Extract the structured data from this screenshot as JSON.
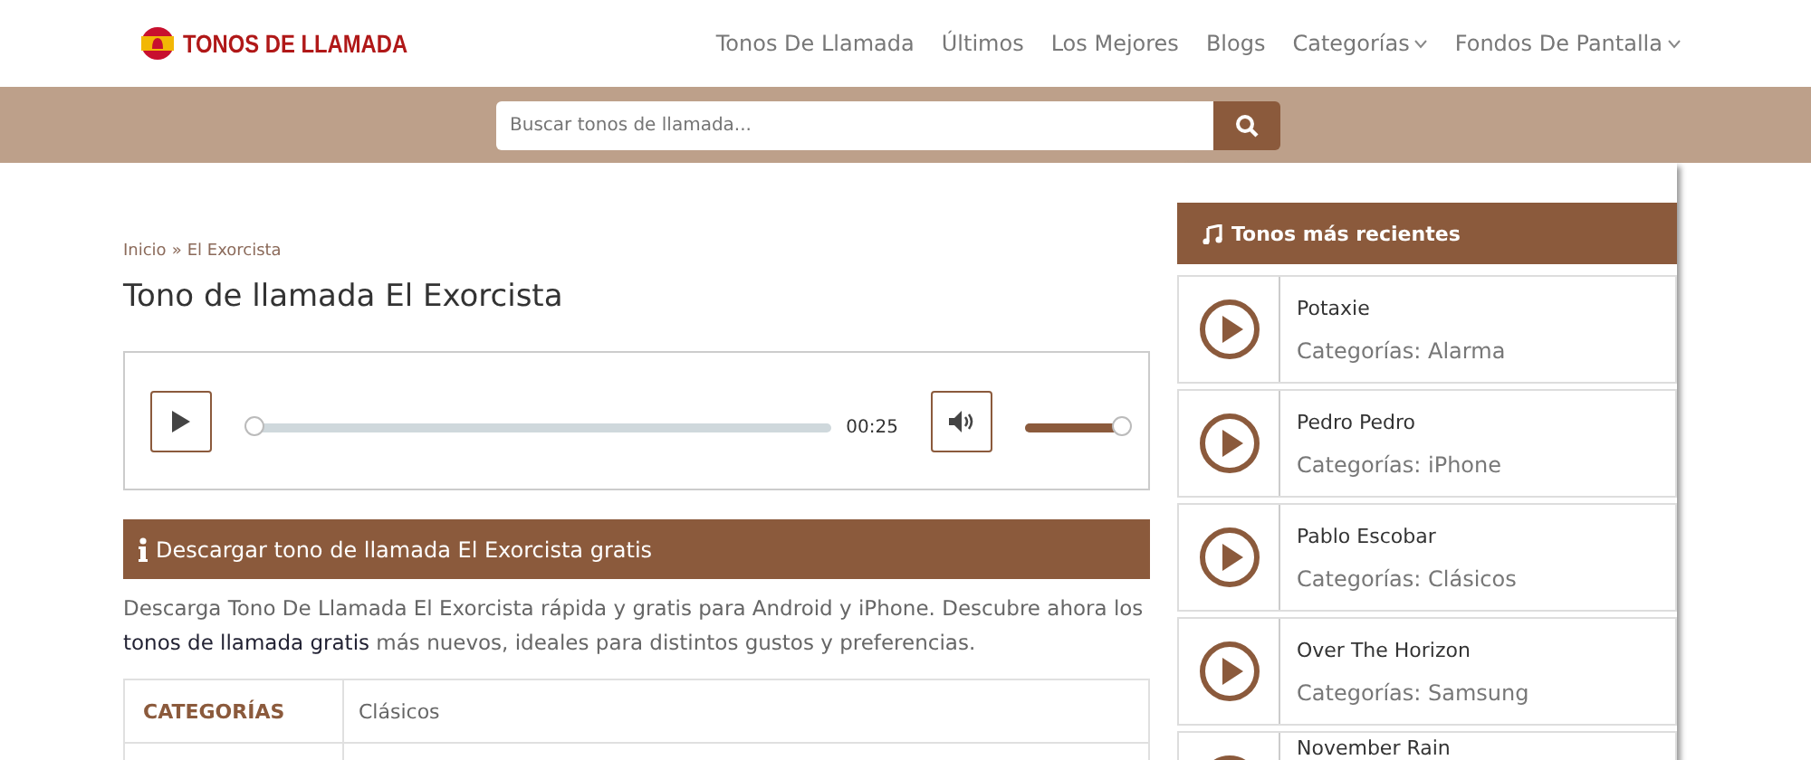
{
  "logo": {
    "text": "TONOS DE LLAMADA"
  },
  "nav": [
    {
      "label": "Tonos De Llamada",
      "dropdown": false
    },
    {
      "label": "Últimos",
      "dropdown": false
    },
    {
      "label": "Los Mejores",
      "dropdown": false
    },
    {
      "label": "Blogs",
      "dropdown": false
    },
    {
      "label": "Categorías",
      "dropdown": true
    },
    {
      "label": "Fondos De Pantalla",
      "dropdown": true
    }
  ],
  "search": {
    "placeholder": "Buscar tonos de llamada..."
  },
  "breadcrumb": {
    "home": "Inicio",
    "separator": "»",
    "current": "El Exorcista"
  },
  "title": "Tono de llamada El Exorcista",
  "player": {
    "progress": {
      "level": 0
    },
    "time": "00:25",
    "volume": {
      "level": 1
    }
  },
  "info_bar": "Descargar tono de llamada El Exorcista gratis",
  "description": {
    "before": "Descarga Tono De Llamada El Exorcista rápida y gratis para Android y iPhone. Descubre ahora los ",
    "link": "tonos de llamada gratis",
    "after": " más nuevos, ideales para distintos gustos y preferencias."
  },
  "table": {
    "rows": [
      {
        "label": "CATEGORÍAS",
        "value": "Clásicos"
      }
    ]
  },
  "sidebar": {
    "title": "Tonos más recientes",
    "items": [
      {
        "name": "Potaxie",
        "category": "Categorías: Alarma"
      },
      {
        "name": "Pedro Pedro",
        "category": "Categorías: iPhone"
      },
      {
        "name": "Pablo Escobar",
        "category": "Categorías: Clásicos"
      },
      {
        "name": "Over The Horizon",
        "category": "Categorías: Samsung"
      },
      {
        "name": "November Rain"
      }
    ]
  }
}
